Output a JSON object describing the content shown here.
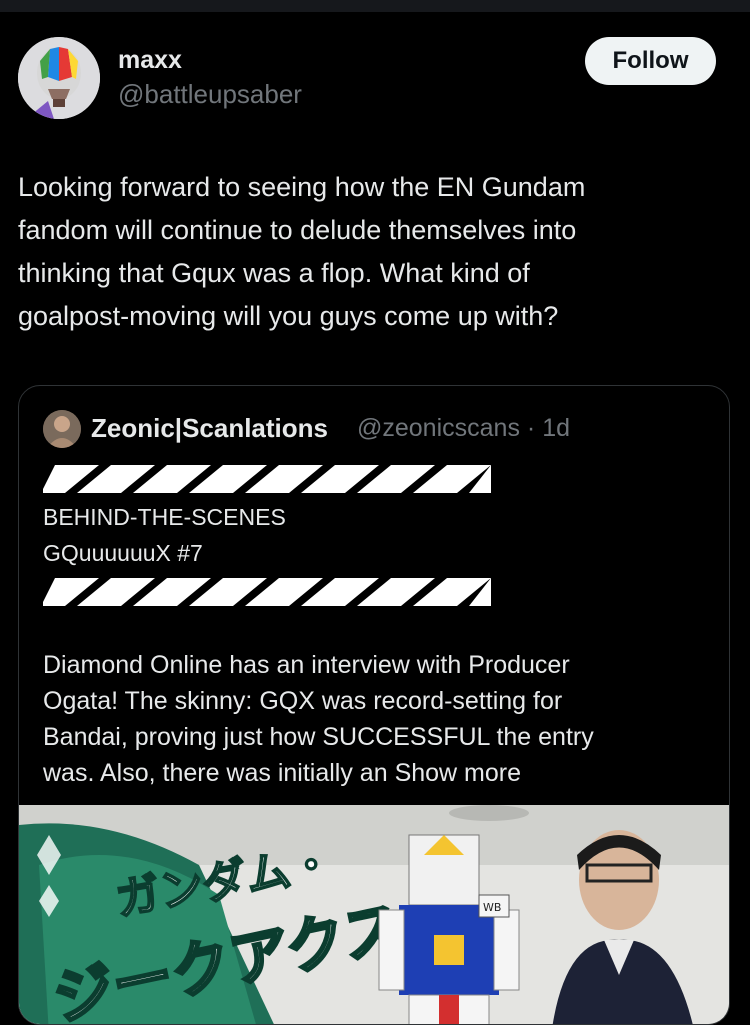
{
  "post": {
    "author": {
      "name": "maxx",
      "handle": "@battleupsaber"
    },
    "follow_label": "Follow",
    "text": "Looking forward to seeing how the EN Gundam\nfandom will continue to delude themselves into\nthinking that Gqux was a flop. What kind of\ngoalpost-moving will you guys come up with?"
  },
  "quote": {
    "author": {
      "name": "Zeonic|Scanlations",
      "handle": "@zeonicscans",
      "time": "1d"
    },
    "separator": "·",
    "line1": "BEHIND-THE-SCENES",
    "line2": "GQuuuuuuX #7",
    "body": "Diamond Online has an interview with Producer\nOgata! The skinny: GQX was record-setting for\nBandai, proving just how SUCCESSFUL the entry\nwas. Also, there was initially an",
    "show_more": "Show more",
    "media": {
      "title_text": "ガンダム・ジークアクスの舞台裏",
      "badge": "WB"
    }
  },
  "colors": {
    "background": "#000000",
    "text": "#e7e9ea",
    "muted": "#71767b",
    "border": "#2f3336",
    "button_bg": "#eff3f4"
  }
}
